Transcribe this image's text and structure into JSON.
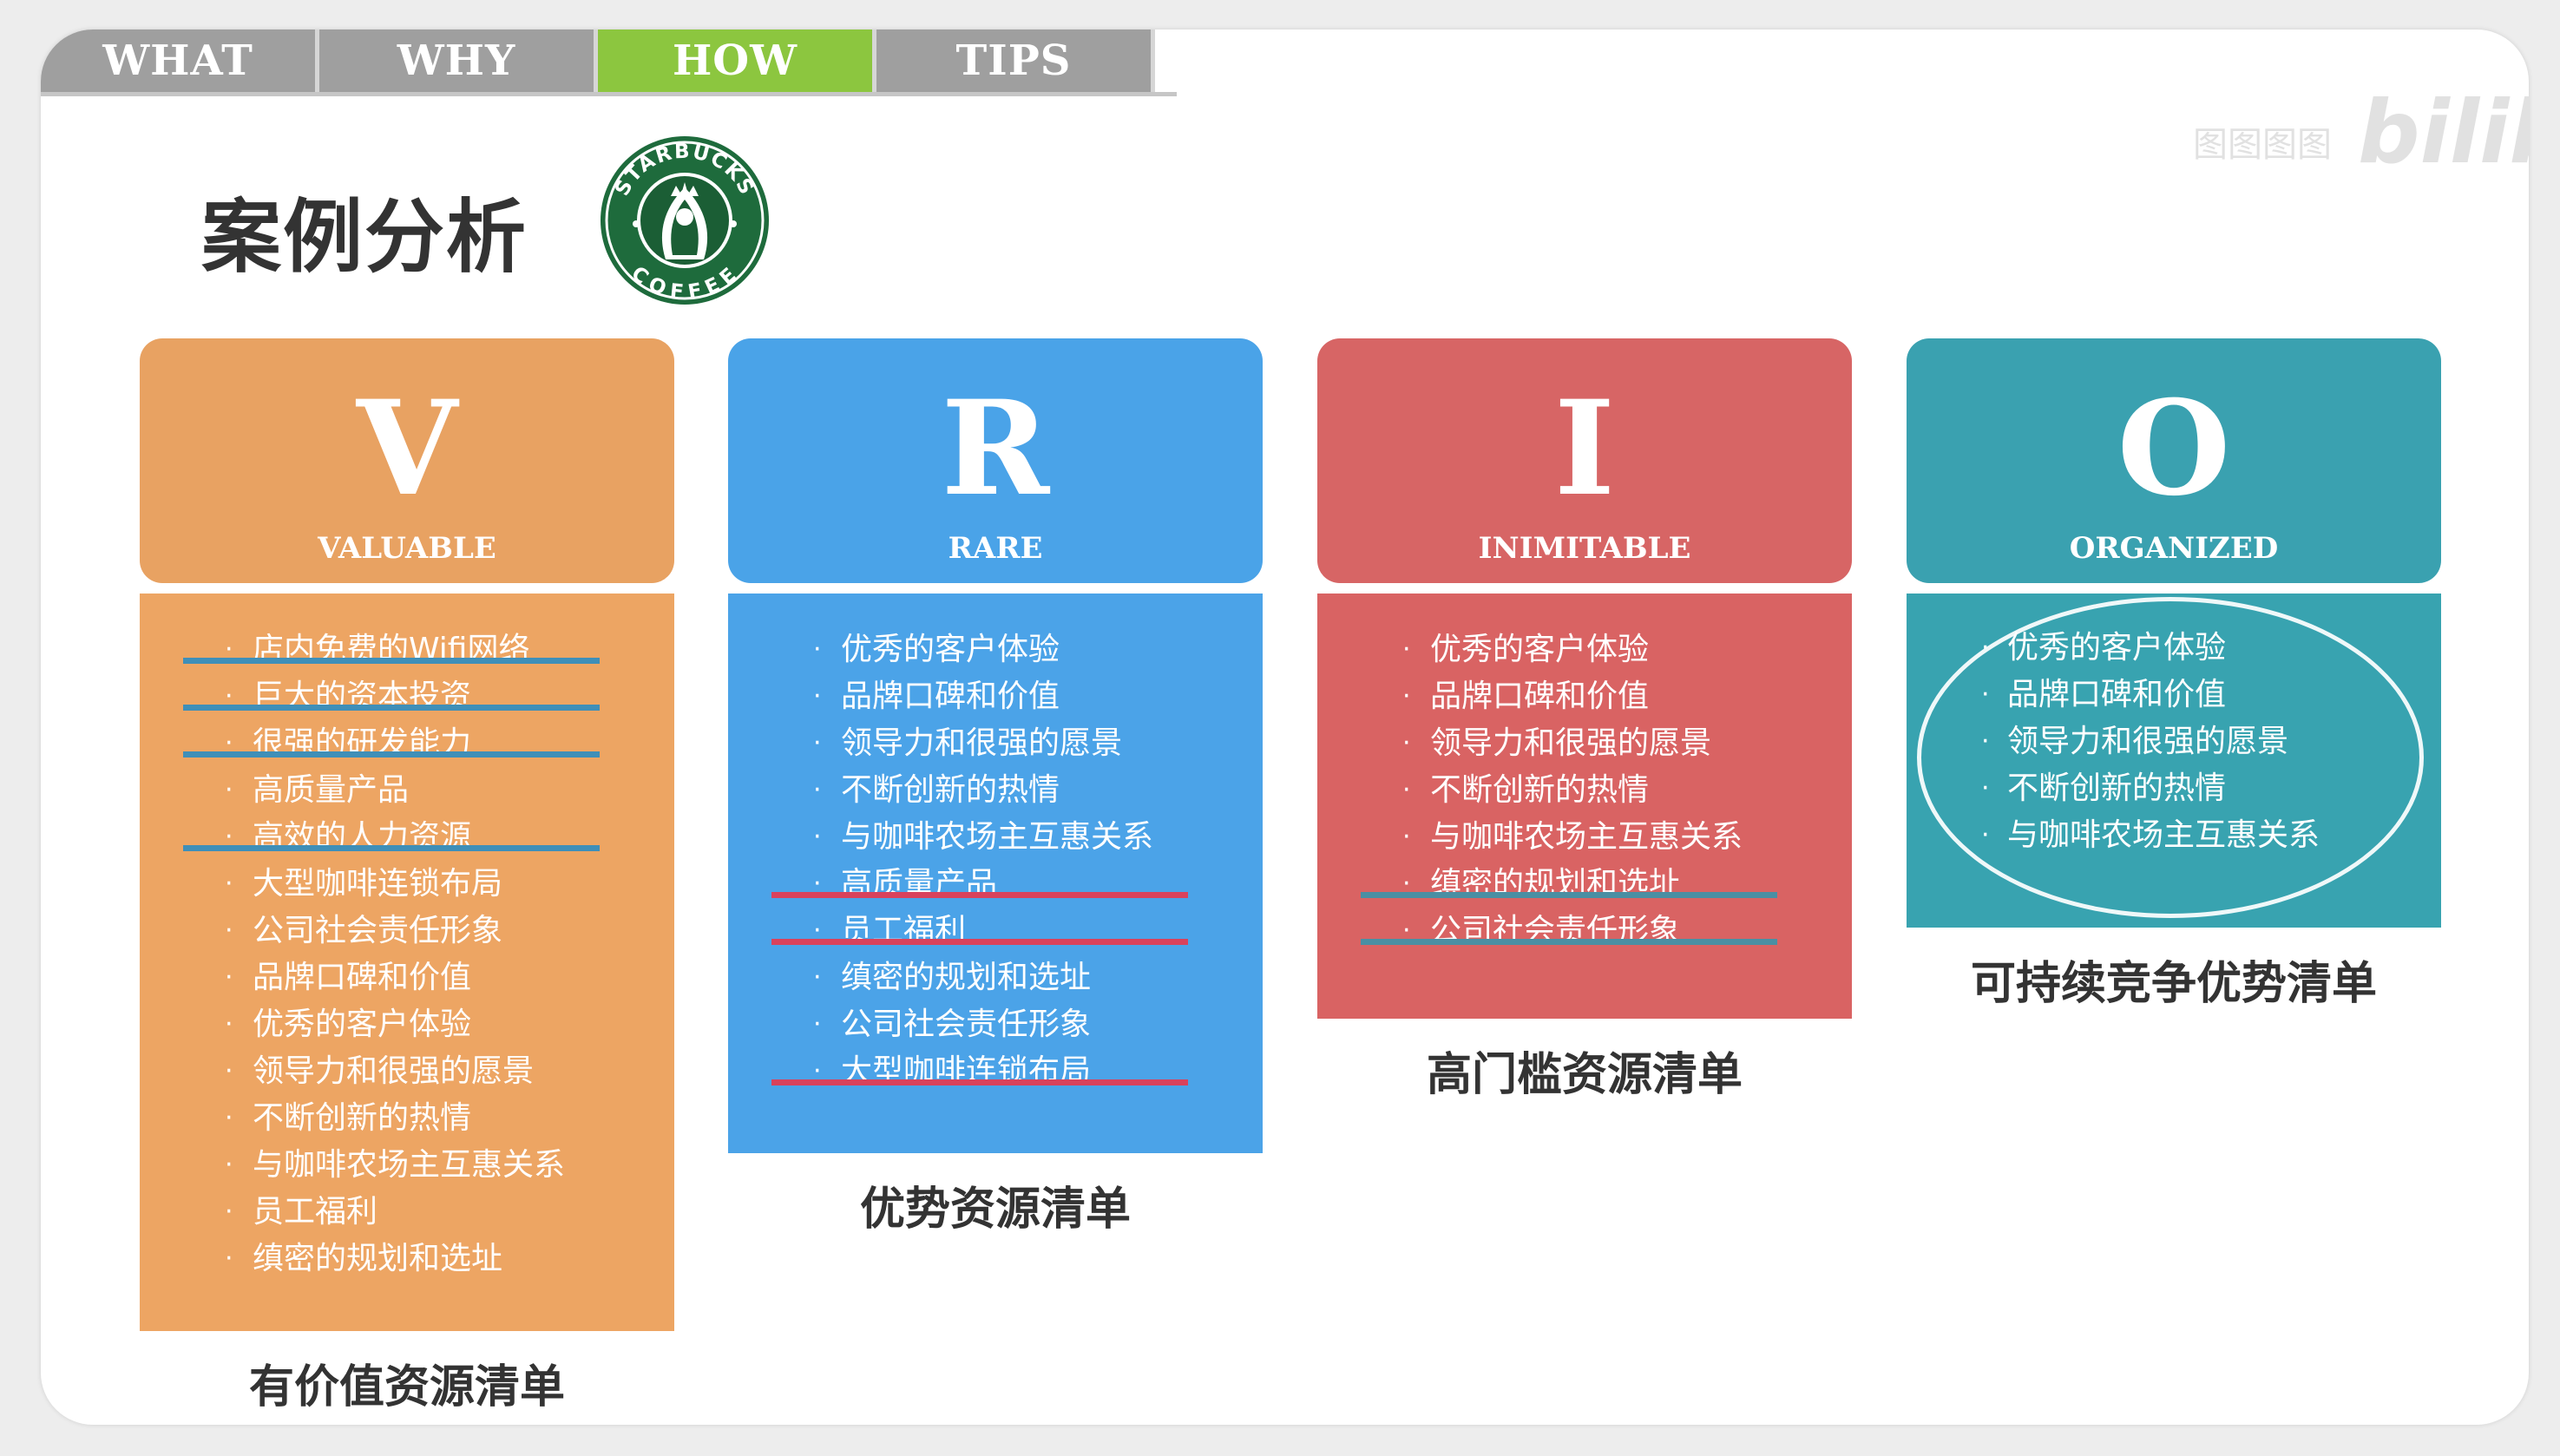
{
  "tabs": [
    {
      "label": "WHAT",
      "active": false
    },
    {
      "label": "WHY",
      "active": false
    },
    {
      "label": "HOW",
      "active": true
    },
    {
      "label": "TIPS",
      "active": false
    }
  ],
  "watermark": {
    "small_text": "图图图图",
    "brand": "bilibili"
  },
  "page_title": "案例分析",
  "logo": {
    "icon": "starbucks-logo-icon",
    "top_text": "STARBUCKS",
    "bottom_text": "COFFEE"
  },
  "colors": {
    "tab_gray": "#9f9f9f",
    "tab_active": "#8cc63f",
    "valuable": "#eda563",
    "rare": "#4ba3e8",
    "inimitable": "#d96363",
    "organized": "#38a3b0",
    "strike_blue": "#3f8fb8",
    "strike_red": "#d9425c",
    "strike_teal": "#4a8fa3"
  },
  "columns": [
    {
      "letter": "V",
      "word": "VALUABLE",
      "caption": "有价值资源清单",
      "items": [
        {
          "text": "店内免费的Wifi网络",
          "struck": true
        },
        {
          "text": "巨大的资本投资",
          "struck": true
        },
        {
          "text": "很强的研发能力",
          "struck": true
        },
        {
          "text": "高质量产品",
          "struck": false
        },
        {
          "text": "高效的人力资源",
          "struck": true
        },
        {
          "text": "大型咖啡连锁布局",
          "struck": false
        },
        {
          "text": "公司社会责任形象",
          "struck": false
        },
        {
          "text": "品牌口碑和价值",
          "struck": false
        },
        {
          "text": "优秀的客户体验",
          "struck": false
        },
        {
          "text": "领导力和很强的愿景",
          "struck": false
        },
        {
          "text": "不断创新的热情",
          "struck": false
        },
        {
          "text": "与咖啡农场主互惠关系",
          "struck": false
        },
        {
          "text": "员工福利",
          "struck": false
        },
        {
          "text": "缜密的规划和选址",
          "struck": false
        }
      ]
    },
    {
      "letter": "R",
      "word": "RARE",
      "caption": "优势资源清单",
      "items": [
        {
          "text": "优秀的客户体验",
          "struck": false
        },
        {
          "text": "品牌口碑和价值",
          "struck": false
        },
        {
          "text": "领导力和很强的愿景",
          "struck": false
        },
        {
          "text": "不断创新的热情",
          "struck": false
        },
        {
          "text": "与咖啡农场主互惠关系",
          "struck": false
        },
        {
          "text": "高质量产品",
          "struck": true
        },
        {
          "text": "员工福利",
          "struck": true
        },
        {
          "text": "缜密的规划和选址",
          "struck": false
        },
        {
          "text": "公司社会责任形象",
          "struck": false
        },
        {
          "text": "大型咖啡连锁布局",
          "struck": true
        }
      ]
    },
    {
      "letter": "I",
      "word": "INIMITABLE",
      "caption": "高门槛资源清单",
      "items": [
        {
          "text": "优秀的客户体验",
          "struck": false
        },
        {
          "text": "品牌口碑和价值",
          "struck": false
        },
        {
          "text": "领导力和很强的愿景",
          "struck": false
        },
        {
          "text": "不断创新的热情",
          "struck": false
        },
        {
          "text": "与咖啡农场主互惠关系",
          "struck": false
        },
        {
          "text": "缜密的规划和选址",
          "struck": true
        },
        {
          "text": "公司社会责任形象",
          "struck": true
        }
      ]
    },
    {
      "letter": "O",
      "word": "ORGANIZED",
      "caption": "可持续竞争优势清单",
      "items": [
        {
          "text": "优秀的客户体验",
          "struck": false
        },
        {
          "text": "品牌口碑和价值",
          "struck": false
        },
        {
          "text": "领导力和很强的愿景",
          "struck": false
        },
        {
          "text": "不断创新的热情",
          "struck": false
        },
        {
          "text": "与咖啡农场主互惠关系",
          "struck": false
        }
      ]
    }
  ]
}
